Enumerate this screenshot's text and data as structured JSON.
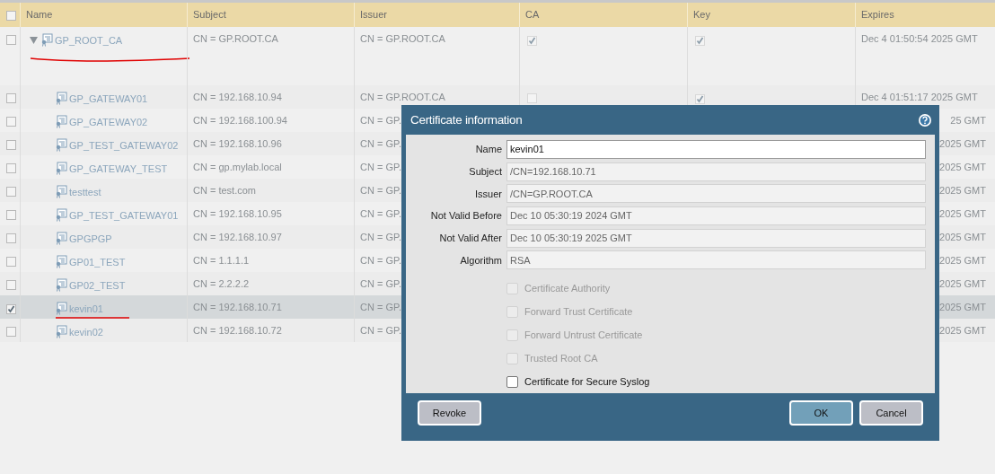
{
  "table": {
    "all_checked": false,
    "columns": [
      "Name",
      "Subject",
      "Issuer",
      "CA",
      "Key",
      "Expires"
    ],
    "rows": [
      {
        "name": "GP_ROOT_CA",
        "subject": "CN = GP.ROOT.CA",
        "issuer": "CN = GP.ROOT.CA",
        "ca": true,
        "key": true,
        "expires": "Dec 4 01:50:54 2025 GMT",
        "selected": false,
        "expanded": true,
        "children": [
          {
            "name": "GP_GATEWAY01",
            "subject": "CN = 192.168.10.94",
            "issuer": "CN = GP.ROOT.CA",
            "ca": false,
            "key": true,
            "expires": "Dec 4 01:51:17 2025 GMT",
            "selected": false
          },
          {
            "name": "GP_GATEWAY02",
            "subject": "CN = 192.168.100.94",
            "issuer": "CN = GP.",
            "expires": "25 GMT",
            "selected": false
          },
          {
            "name": "GP_TEST_GATEWAY02",
            "subject": "CN = 192.168.10.96",
            "issuer": "CN = GP.",
            "expires": "2025 GMT",
            "selected": false
          },
          {
            "name": "GP_GATEWAY_TEST",
            "subject": "CN = gp.mylab.local",
            "issuer": "CN = GP.",
            "expires": "2025 GMT",
            "selected": false
          },
          {
            "name": "testtest",
            "subject": "CN = test.com",
            "issuer": "CN = GP.",
            "expires": "2025 GMT",
            "selected": false
          },
          {
            "name": "GP_TEST_GATEWAY01",
            "subject": "CN = 192.168.10.95",
            "issuer": "CN = GP.",
            "expires": "2025 GMT",
            "selected": false
          },
          {
            "name": "GPGPGP",
            "subject": "CN = 192.168.10.97",
            "issuer": "CN = GP.",
            "expires": "2025 GMT",
            "selected": false
          },
          {
            "name": "GP01_TEST",
            "subject": "CN = 1.1.1.1",
            "issuer": "CN = GP.",
            "expires": "2025 GMT",
            "selected": false
          },
          {
            "name": "GP02_TEST",
            "subject": "CN = 2.2.2.2",
            "issuer": "CN = GP.",
            "expires": "2025 GMT",
            "selected": false
          },
          {
            "name": "kevin01",
            "subject": "CN = 192.168.10.71",
            "issuer": "CN = GP.",
            "expires": "2025 GMT",
            "selected": true
          },
          {
            "name": "kevin02",
            "subject": "CN = 192.168.10.72",
            "issuer": "CN = GP.",
            "expires": "2025 GMT",
            "selected": false
          }
        ]
      }
    ]
  },
  "dialog": {
    "title": "Certificate information",
    "fields": [
      {
        "label": "Name",
        "value": "kevin01",
        "disabled": false
      },
      {
        "label": "Subject",
        "value": "/CN=192.168.10.71",
        "disabled": true
      },
      {
        "label": "Issuer",
        "value": "/CN=GP.ROOT.CA",
        "disabled": true
      },
      {
        "label": "Not Valid Before",
        "value": "Dec 10 05:30:19 2024 GMT",
        "disabled": true
      },
      {
        "label": "Not Valid After",
        "value": "Dec 10 05:30:19 2025 GMT",
        "disabled": true
      },
      {
        "label": "Algorithm",
        "value": "RSA",
        "disabled": true
      }
    ],
    "options": [
      {
        "label": "Certificate Authority",
        "checked": false,
        "disabled": true
      },
      {
        "label": "Forward Trust Certificate",
        "checked": false,
        "disabled": true
      },
      {
        "label": "Forward Untrust Certificate",
        "checked": false,
        "disabled": true
      },
      {
        "label": "Trusted Root CA",
        "checked": false,
        "disabled": true
      },
      {
        "label": "Certificate for Secure Syslog",
        "checked": false,
        "disabled": false
      }
    ],
    "buttons": [
      {
        "label": "Revoke",
        "primary": false
      },
      {
        "label": "OK",
        "primary": true
      },
      {
        "label": "Cancel",
        "primary": false
      }
    ]
  }
}
